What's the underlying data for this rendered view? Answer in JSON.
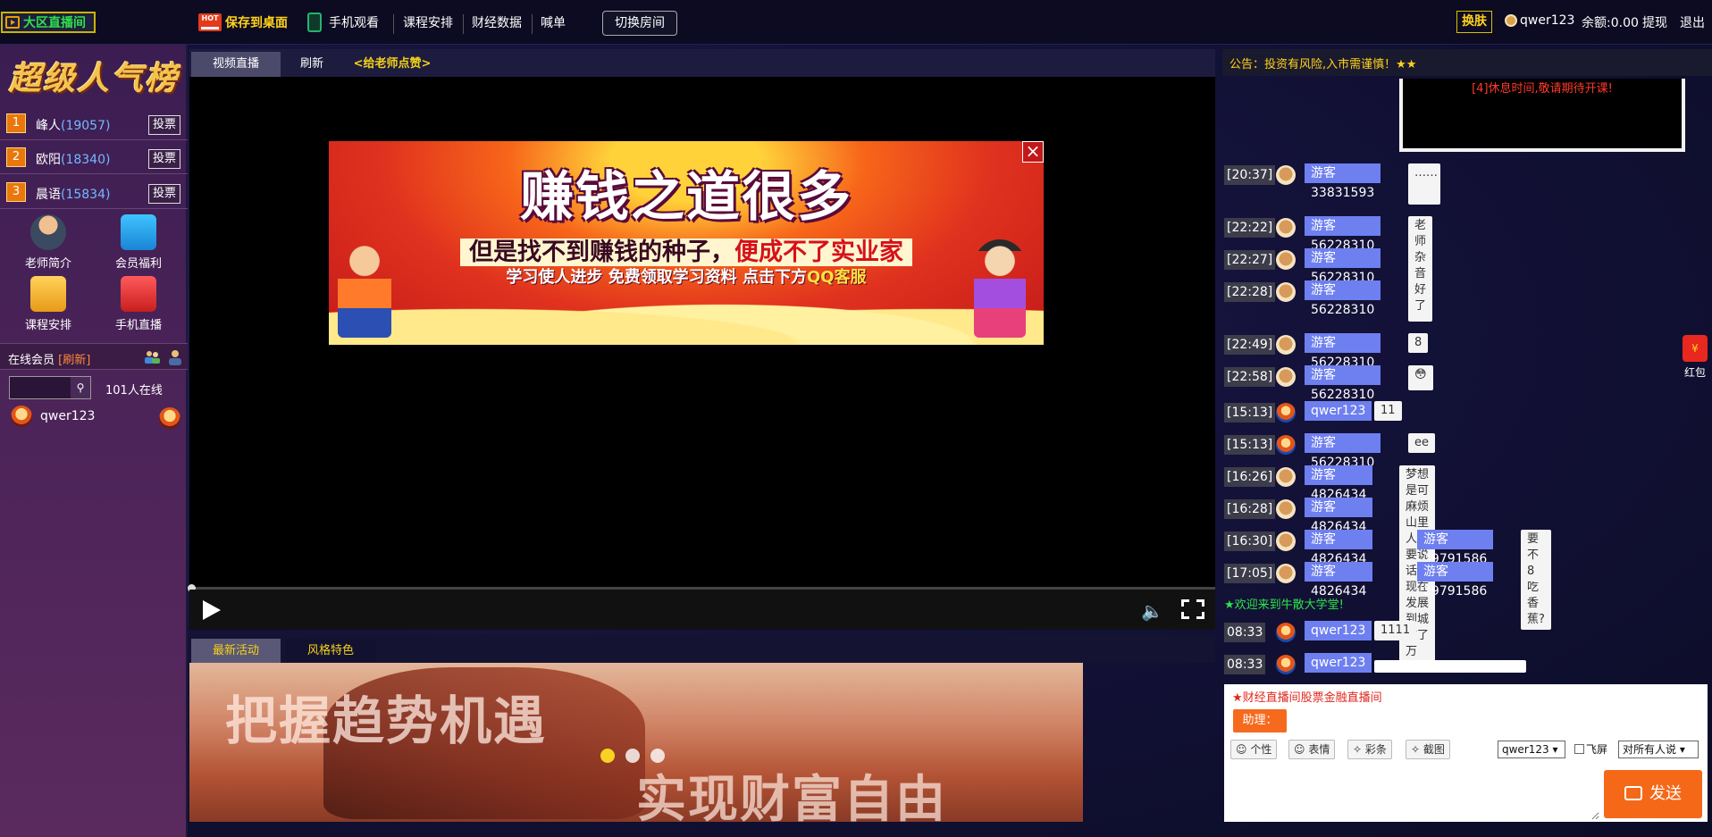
{
  "topbar": {
    "logo": "大区直播间",
    "hot_badge": "HOT",
    "save_desktop": "保存到桌面",
    "mobile_watch": "手机观看",
    "course": "课程安排",
    "finance": "财经数据",
    "shout": "喊单",
    "switch_room": "切换房间",
    "skin": "换肤",
    "username": "qwer123",
    "balance": "余额:0.00",
    "withdraw": "提现",
    "logout": "退出"
  },
  "sidebar": {
    "title": "超级人气榜",
    "ranks": [
      {
        "num": "1",
        "name": "峰人",
        "votes": "(19057)",
        "vote": "投票"
      },
      {
        "num": "2",
        "name": "欧阳",
        "votes": "(18340)",
        "vote": "投票"
      },
      {
        "num": "3",
        "name": "晨语",
        "votes": "(15834)",
        "vote": "投票"
      }
    ],
    "features": [
      "老师简介",
      "会员福利",
      "课程安排",
      "手机直播"
    ],
    "online_label": "在线会员",
    "refresh": "[刷新]",
    "online_count": "101人在线",
    "online_user": "qwer123"
  },
  "video": {
    "tab_live": "视频直播",
    "tab_refresh": "刷新",
    "tab_like": "<给老师点赞>",
    "ad_line1": "赚钱之道很多",
    "ad_line2a": "但是找不到赚钱的种子，",
    "ad_line2b": "便成不了实业家",
    "ad_line3a": "学习使人进步 免费领取学习资料 点击下方",
    "ad_line3b": "QQ客服",
    "ad_close": "×"
  },
  "activity": {
    "tab_latest": "最新活动",
    "tab_style": "风格特色",
    "banner_line1": "把握趋势机遇",
    "banner_line2": "实现财富自由"
  },
  "chat": {
    "notice": "公告：投资有风险,入市需谨慎！★★",
    "break_notice": "[4]休息时间,敬请期待开课!",
    "messages": [
      {
        "time": "[20:37]",
        "name": "游客33831593",
        "text": "……"
      },
      {
        "time": "[22:22]",
        "name": "游客56228310",
        "text": "老师好"
      },
      {
        "time": "[22:27]",
        "name": "游客56228310",
        "text": "杂音太大"
      },
      {
        "time": "[22:28]",
        "name": "游客56228310",
        "text": "好了"
      },
      {
        "time": "[22:49]",
        "name": "游客56228310",
        "text": "8"
      },
      {
        "time": "[22:58]",
        "name": "游客56228310",
        "text": "😳"
      },
      {
        "time": "[15:13]",
        "name": "qwer123",
        "text": "11"
      },
      {
        "time": "[15:13]",
        "name": "游客56228310",
        "text": "ee"
      },
      {
        "time": "[16:26]",
        "name": "游客4826434",
        "text": "梦想是可以有的，早点干就早点散，早点赚够二千万"
      },
      {
        "time": "[16:28]",
        "name": "游客4826434",
        "text": "麻烦山里人不要说话，现在发展到城市了"
      },
      {
        "time": "[16:30]",
        "name": "游客4826434",
        "to": "游客29791586",
        "text": "要不要吃香蕉?"
      },
      {
        "time": "[17:05]",
        "name": "游客4826434",
        "to": "游客29791586",
        "text": "8"
      }
    ],
    "welcome": "★欢迎来到牛散大学堂!",
    "recent": [
      {
        "time": "08:33",
        "name": "qwer123",
        "text": "1111"
      },
      {
        "time": "08:33",
        "name": "qwer123",
        "text": ""
      }
    ],
    "red_packet": "红包",
    "input": {
      "hint": "★财经直播间股票金融直播间",
      "assistant": "助理：",
      "tools": [
        "个性",
        "表情",
        "彩条",
        "截图"
      ],
      "user_select": "qwer123",
      "fly_screen": "飞屏",
      "target_select": "对所有人说",
      "send": "发送"
    }
  }
}
